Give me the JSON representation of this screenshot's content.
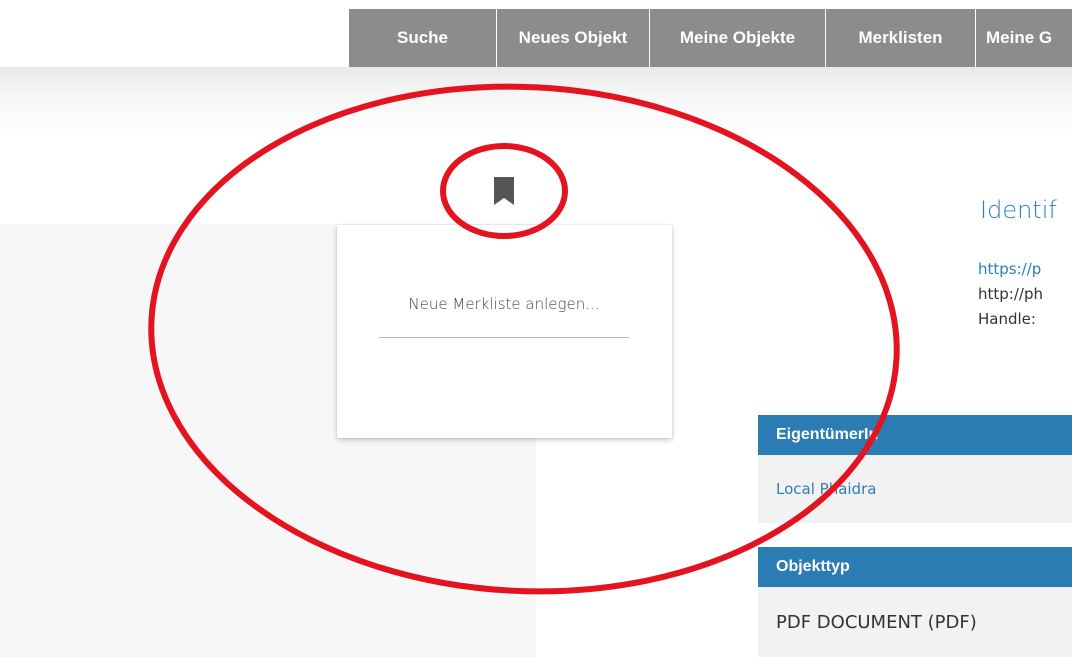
{
  "nav": {
    "items": [
      {
        "label": "Suche"
      },
      {
        "label": "Neues Objekt"
      },
      {
        "label": "Meine Objekte"
      },
      {
        "label": "Merklisten"
      },
      {
        "label": "Meine G"
      }
    ]
  },
  "bookmark": {
    "icon": "bookmark-icon"
  },
  "dropdown": {
    "new_list_label": "Neue Merkliste anlegen..."
  },
  "identifiers": {
    "title": "Identif",
    "lines": [
      "https://p",
      "http://ph",
      "Handle: "
    ]
  },
  "owner": {
    "header": "EigentümerIn",
    "value": "Local Phaidra"
  },
  "object_type": {
    "header": "Objekttyp",
    "value": "PDF DOCUMENT (PDF)"
  },
  "colors": {
    "nav_bg": "#8c8c8c",
    "accent_blue": "#2a7cb3",
    "annotation_red": "#e3141f"
  }
}
